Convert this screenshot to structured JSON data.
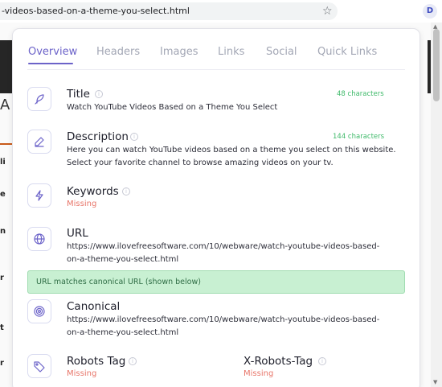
{
  "browser": {
    "url": "-videos-based-on-a-theme-you-select.html",
    "star_icon": "star-icon",
    "extension_letter": "D"
  },
  "background": {
    "fragments": [
      "A",
      "li",
      "e",
      "n",
      "r",
      "t",
      "r"
    ]
  },
  "tabs": [
    {
      "label": "Overview",
      "active": true
    },
    {
      "label": "Headers",
      "active": false
    },
    {
      "label": "Images",
      "active": false
    },
    {
      "label": "Links",
      "active": false
    },
    {
      "label": "Social",
      "active": false
    },
    {
      "label": "Quick Links",
      "active": false
    }
  ],
  "title": {
    "label": "Title",
    "icon": "feather-icon",
    "value": "Watch YouTube Videos Based on a Theme You Select",
    "count": "48 characters"
  },
  "description": {
    "label": "Description",
    "icon": "pencil-icon",
    "value_line1": "Here you can watch YouTube videos based on a theme you select on this website.",
    "value_line2": "Select your favorite channel to browse amazing videos on your tv.",
    "count": "144 characters"
  },
  "keywords": {
    "label": "Keywords",
    "icon": "lightning-icon",
    "status": "Missing"
  },
  "url_section": {
    "label": "URL",
    "icon": "globe-icon",
    "value_line1": "https://www.ilovefreesoftware.com/10/webware/watch-youtube-videos-based-",
    "value_line2": "on-a-theme-you-select.html"
  },
  "canonical_match": "URL matches canonical URL (shown below)",
  "canonical": {
    "label": "Canonical",
    "icon": "target-icon",
    "value_line1": "https://www.ilovefreesoftware.com/10/webware/watch-youtube-videos-based-",
    "value_line2": "on-a-theme-you-select.html"
  },
  "robots": {
    "label": "Robots Tag",
    "icon": "tag-icon",
    "status": "Missing"
  },
  "x_robots": {
    "label": "X-Robots-Tag",
    "status": "Missing"
  },
  "colors": {
    "accent": "#6c63c9",
    "success": "#3fba6a",
    "missing": "#e8766a",
    "match_bg": "#c8f0d2"
  }
}
